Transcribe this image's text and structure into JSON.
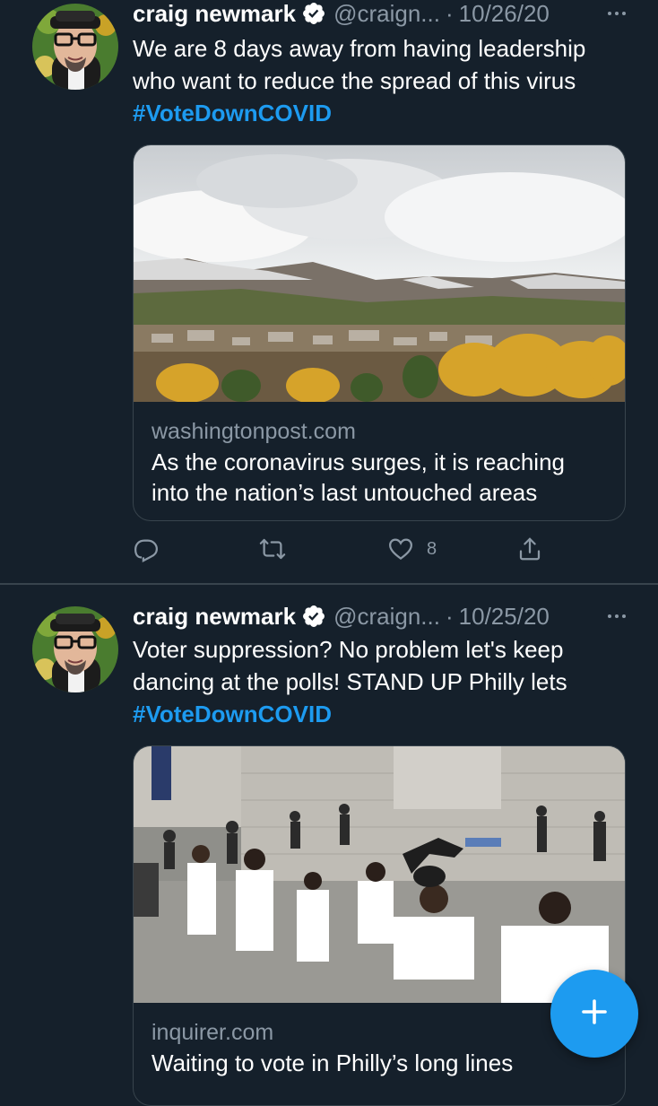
{
  "theme": {
    "background": "#15202b",
    "divider": "#38444d",
    "accent": "#1d9bf0",
    "muted": "#8b98a5",
    "text": "#ffffff"
  },
  "tweets": [
    {
      "author_name": "craig newmark",
      "handle": "@craign...",
      "separator": "·",
      "date": "10/26/20",
      "verified": true,
      "avatar_icon": "avatar-craig-newmark",
      "more_icon": "more-dots-icon",
      "text": "We are 8 days away from having leadership who want to reduce the spread of this virus",
      "hashtag": "#VoteDownCOVID",
      "card": {
        "image_alt": "mountain-town-autumn-photo",
        "domain": "washingtonpost.com",
        "title": "As the coronavirus surges, it is reaching into the nation’s last untouched areas"
      },
      "actions": {
        "reply_icon": "reply-icon",
        "retweet_icon": "retweet-icon",
        "like_icon": "heart-icon",
        "like_count": "8",
        "share_icon": "share-icon"
      }
    },
    {
      "author_name": "craig newmark",
      "handle": "@craign...",
      "separator": "·",
      "date": "10/25/20",
      "verified": true,
      "avatar_icon": "avatar-craig-newmark",
      "more_icon": "more-dots-icon",
      "text": "Voter suppression? No problem let's keep dancing at the polls! STAND UP Philly lets",
      "hashtag": "#VoteDownCOVID",
      "card": {
        "image_alt": "dancing-at-polls-photo",
        "domain": "inquirer.com",
        "title": "Waiting to vote in Philly’s long lines"
      }
    }
  ],
  "compose_button": {
    "icon": "plus-icon"
  }
}
